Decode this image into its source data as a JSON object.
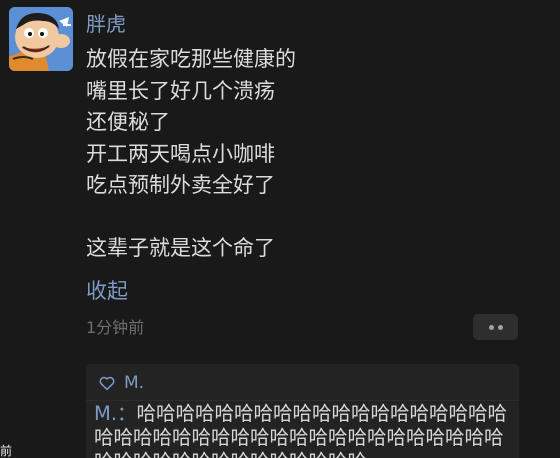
{
  "post": {
    "username": "胖虎",
    "lines": [
      "放假在家吃那些健康的",
      "嘴里长了好几个溃疡",
      "还便秘了",
      "开工两天喝点小咖啡",
      "吃点预制外卖全好了",
      "",
      "这辈子就是这个命了"
    ],
    "collapse_label": "收起",
    "timestamp": "1分钟前"
  },
  "interactions": {
    "likes": [
      "M."
    ],
    "comments": [
      {
        "author": "M.",
        "separator": "：",
        "text": "哈哈哈哈哈哈哈哈哈哈哈哈哈哈哈哈哈哈哈哈哈哈哈哈哈哈哈哈哈哈哈哈哈哈哈哈哈哈哈哈哈哈哈哈哈哈哈哈哈哈哈哈哈哈"
      }
    ]
  },
  "edge_text": "前",
  "colors": {
    "background": "#191919",
    "name_link": "#7e9ac4",
    "body_text": "#dcdcdc",
    "muted": "#6e6e6e",
    "panel": "#232323"
  }
}
